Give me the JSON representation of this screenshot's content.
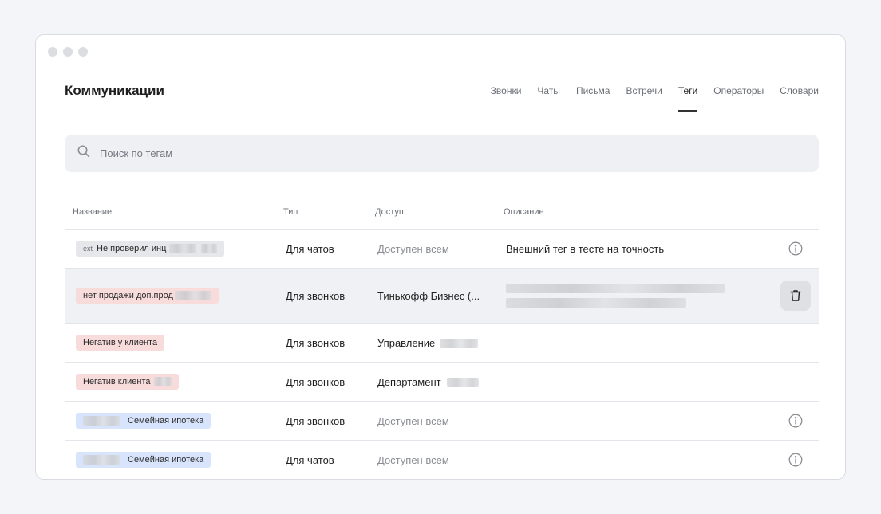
{
  "window": {
    "controls": [
      "close",
      "minimize",
      "maximize"
    ]
  },
  "header": {
    "title": "Коммуникации",
    "tabs": [
      {
        "label": "Звонки",
        "active": false
      },
      {
        "label": "Чаты",
        "active": false
      },
      {
        "label": "Письма",
        "active": false
      },
      {
        "label": "Встречи",
        "active": false
      },
      {
        "label": "Теги",
        "active": true
      },
      {
        "label": "Операторы",
        "active": false
      },
      {
        "label": "Словари",
        "active": false
      }
    ]
  },
  "search": {
    "placeholder": "Поиск по тегам",
    "value": "",
    "icon": "search-icon"
  },
  "table": {
    "columns": [
      "Название",
      "Тип",
      "Доступ",
      "Описание"
    ],
    "rows": [
      {
        "tag_prefix": "ext",
        "tag": "Не проверил инц",
        "tag_color": "grey",
        "type": "Для чатов",
        "access": "Доступен всем",
        "access_muted": true,
        "description": "Внешний тег в тесте на точность",
        "action": "info-icon"
      },
      {
        "tag_prefix": "",
        "tag": "нет продажи доп.прод",
        "tag_color": "red",
        "type": "Для звонков",
        "access": "Тинькофф Бизнес (...",
        "access_muted": false,
        "description": "",
        "action": "trash-icon",
        "highlighted": true
      },
      {
        "tag_prefix": "",
        "tag": "Негатив у клиента",
        "tag_color": "red",
        "type": "Для звонков",
        "access": "Управление",
        "access_muted": false,
        "description": "",
        "action": ""
      },
      {
        "tag_prefix": "",
        "tag": "Негатив клиента",
        "tag_color": "red",
        "type": "Для звонков",
        "access": "Департамент",
        "access_muted": false,
        "description": "",
        "action": ""
      },
      {
        "tag_prefix": "",
        "tag": "Семейная ипотека",
        "tag_color": "blue",
        "type": "Для звонков",
        "access": "Доступен всем",
        "access_muted": true,
        "description": "",
        "action": "info-icon"
      },
      {
        "tag_prefix": "",
        "tag": "Семейная ипотека",
        "tag_color": "blue",
        "type": "Для чатов",
        "access": "Доступен всем",
        "access_muted": true,
        "description": "",
        "action": "info-icon"
      }
    ]
  },
  "colors": {
    "background": "#f4f5f8",
    "tag_grey": "#e6e7ea",
    "tag_red": "#f8dcdc",
    "tag_blue": "#d7e4fb",
    "muted_text": "#8a8d93"
  }
}
